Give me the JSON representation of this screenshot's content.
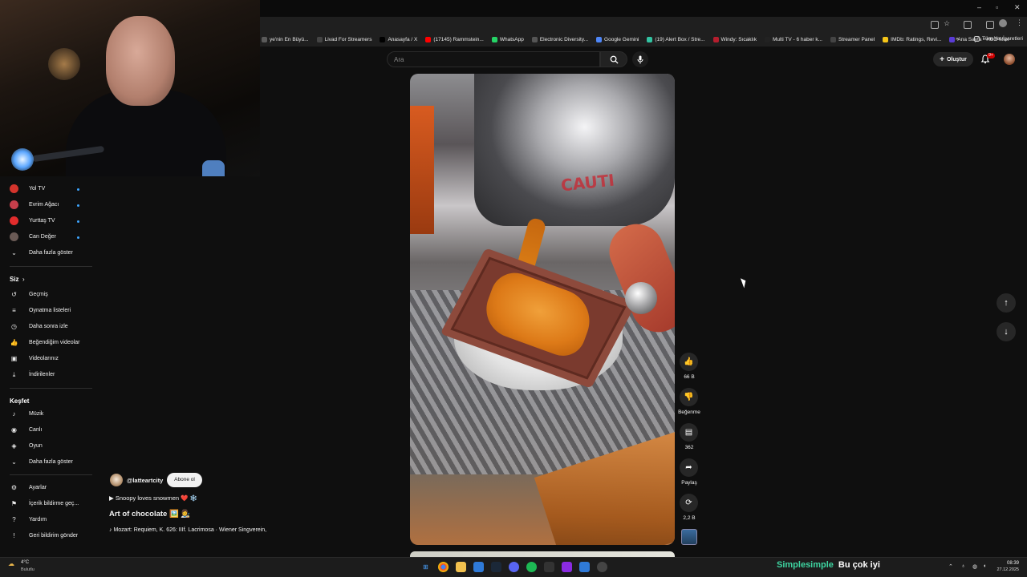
{
  "browser": {
    "bookmarks": [
      {
        "label": "ye'nin En Büyü...",
        "color": "#5a5a5a"
      },
      {
        "label": "Livad For Streamers",
        "color": "#444"
      },
      {
        "label": "Anasayfa / X",
        "color": "#000"
      },
      {
        "label": "(17145) Rammstein...",
        "color": "#ff0000"
      },
      {
        "label": "WhatsApp",
        "color": "#25d366"
      },
      {
        "label": "Electronic Diversity...",
        "color": "#555"
      },
      {
        "label": "Google Gemini",
        "color": "#4e86f7"
      },
      {
        "label": "(19) Alert Box / Stre...",
        "color": "#32c3a2"
      },
      {
        "label": "Windy: Sıcaklık",
        "color": "#b51e2e"
      },
      {
        "label": "Multi TV - 6 haber k...",
        "color": "#222"
      },
      {
        "label": "Streamer Panel",
        "color": "#444"
      },
      {
        "label": "IMDb: Ratings, Revi...",
        "color": "#f5c518"
      },
      {
        "label": "Ana Sayfa • HBO Max",
        "color": "#5a3cd6"
      }
    ],
    "bookmarks_more": "»",
    "all_bookmarks": "Tüm Yer İşaretleri"
  },
  "header": {
    "search_placeholder": "Ara",
    "create_label": "Oluştur",
    "notifications_badge": "9+"
  },
  "sidebar": {
    "channels": [
      {
        "name": "Yol TV",
        "color": "#d4342c",
        "live": true
      },
      {
        "name": "Evrim Ağacı",
        "color": "#c63f4b",
        "live": true
      },
      {
        "name": "Yurttaş TV",
        "color": "#e22c2c",
        "live": true
      },
      {
        "name": "Can Değer",
        "color": "#6a5a55",
        "live": true
      }
    ],
    "show_more_1": "Daha fazla göster",
    "you_heading": "Siz",
    "you_items": [
      {
        "label": "Geçmiş",
        "icon": "history-icon",
        "glyph": "↺"
      },
      {
        "label": "Oynatma listeleri",
        "icon": "playlist-icon",
        "glyph": "≡"
      },
      {
        "label": "Daha sonra izle",
        "icon": "clock-icon",
        "glyph": "◷"
      },
      {
        "label": "Beğendiğim videolar",
        "icon": "thumbs-up-icon",
        "glyph": "👍"
      },
      {
        "label": "Videolarınız",
        "icon": "video-icon",
        "glyph": "▣"
      },
      {
        "label": "İndirilenler",
        "icon": "download-icon",
        "glyph": "⤓"
      }
    ],
    "explore_heading": "Keşfet",
    "explore_items": [
      {
        "label": "Müzik",
        "icon": "music-icon",
        "glyph": "♪"
      },
      {
        "label": "Canlı",
        "icon": "live-icon",
        "glyph": "◉"
      },
      {
        "label": "Oyun",
        "icon": "game-icon",
        "glyph": "◈"
      }
    ],
    "show_more_2": "Daha fazla göster",
    "settings_items": [
      {
        "label": "Ayarlar",
        "icon": "gear-icon",
        "glyph": "⚙"
      },
      {
        "label": "İçerik bildirme geç...",
        "icon": "flag-icon",
        "glyph": "⚑"
      },
      {
        "label": "Yardım",
        "icon": "help-icon",
        "glyph": "?"
      },
      {
        "label": "Geri bildirim gönder",
        "icon": "feedback-icon",
        "glyph": "!"
      }
    ]
  },
  "video": {
    "overlay_text": "CAUTI",
    "channel": "@latteartcity",
    "subscribe": "Abone ol",
    "description": "▶ Snoopy loves snowmen ❤️ ❄️",
    "title": "Art of chocolate 🖼️ 👩‍🎨",
    "music": "♪ Mozart: Requiem, K. 626: IIIf. Lacrimosa · Wiener Singverein,"
  },
  "actions": {
    "likes": "66 B",
    "dislike": "Beğenme",
    "comments": "362",
    "share": "Paylaş",
    "remix": "2,2 B"
  },
  "taskbar": {
    "temperature": "4°C",
    "weather": "Bulutlu",
    "overlay_left": "Simplesimple",
    "overlay_right": "Bu çok iyi",
    "time": "08:39",
    "date": "27.12.2025"
  }
}
